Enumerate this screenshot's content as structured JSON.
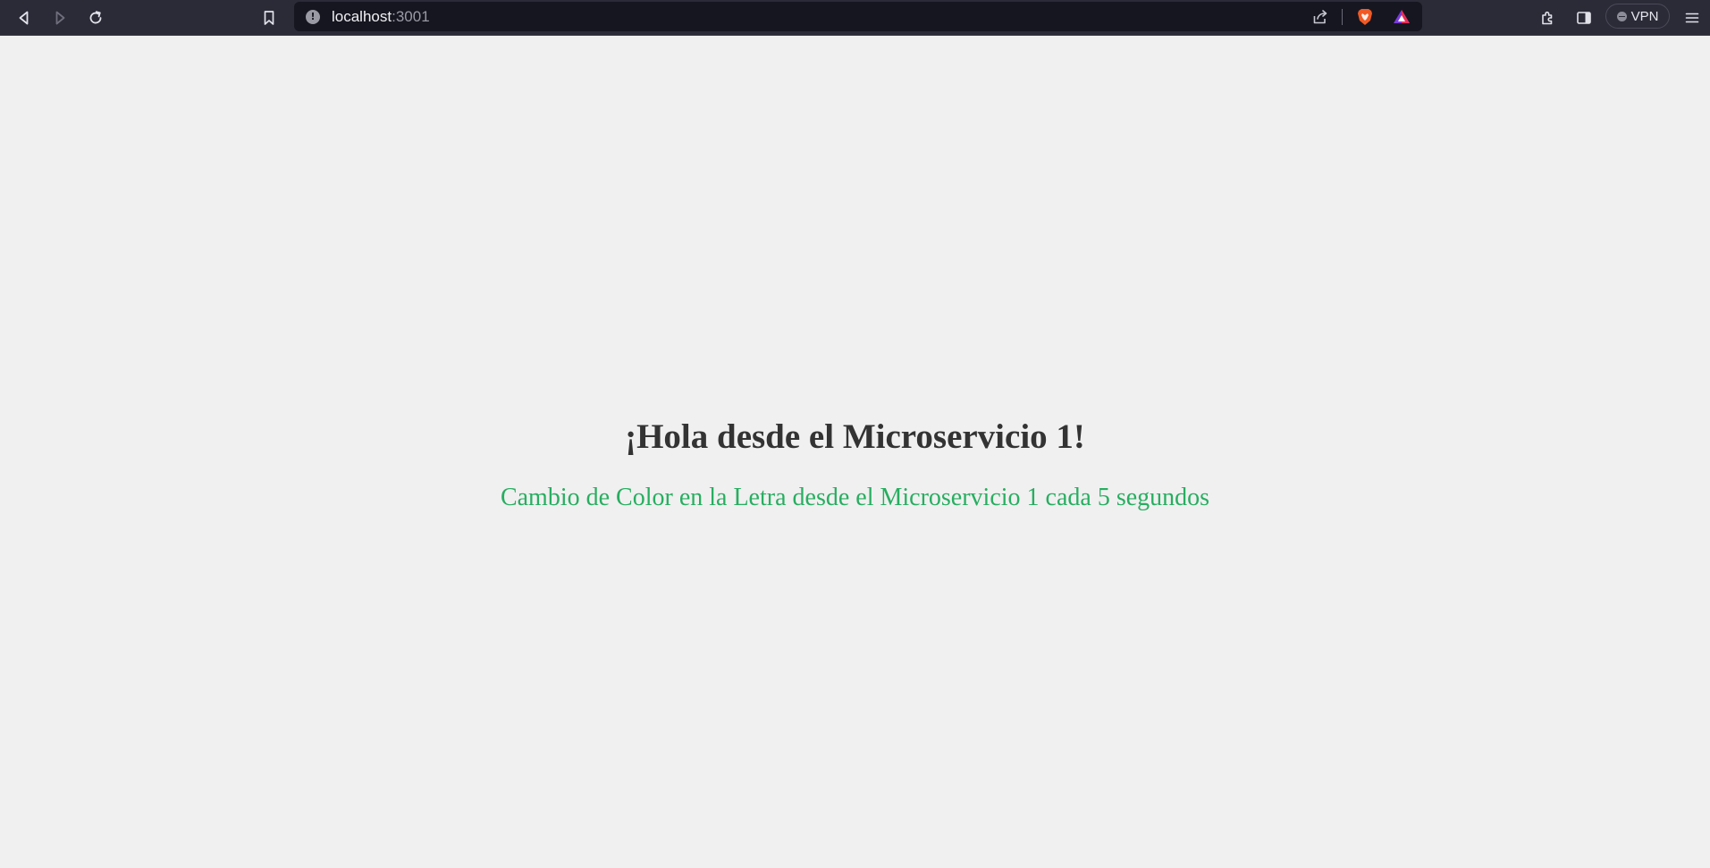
{
  "browser": {
    "url_host": "localhost",
    "url_port": ":3001",
    "vpn_label": "VPN",
    "icons": {
      "back": "back-icon",
      "forward": "forward-icon",
      "reload": "reload-icon",
      "bookmark": "bookmark-icon",
      "site_info": "site-info-icon",
      "share": "share-icon",
      "brave_shields": "brave-shields-icon",
      "brave_rewards": "brave-rewards-icon",
      "extensions": "extensions-icon",
      "sidebar": "sidebar-icon",
      "menu": "menu-icon"
    }
  },
  "page": {
    "heading": "¡Hola desde el Microservicio 1!",
    "subtext": "Cambio de Color en la Letra desde el Microservicio 1 cada 5 segundos",
    "colors": {
      "background": "#f0f0f0",
      "heading": "#333333",
      "subtext": "#27ae60"
    }
  }
}
